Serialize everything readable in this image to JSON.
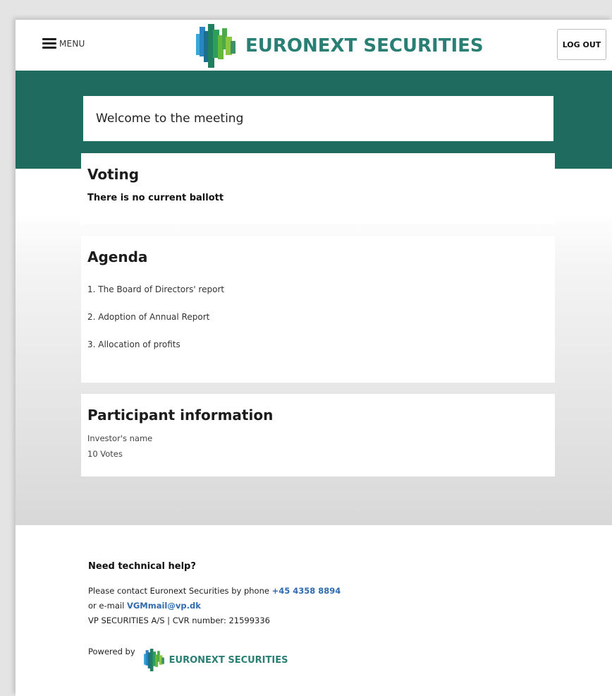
{
  "header": {
    "menu_label": "MENU",
    "brand": "EURONEXT SECURITIES",
    "logout_label": "LOG OUT"
  },
  "welcome": "Welcome to the meeting",
  "voting": {
    "title": "Voting",
    "message": "There is no current ballott"
  },
  "agenda": {
    "title": "Agenda",
    "items": [
      "1. The Board of Directors' report",
      "2. Adoption of Annual Report",
      "3. Allocation of profits"
    ]
  },
  "participant": {
    "title": "Participant information",
    "name": "Investor's name",
    "votes": "10 Votes"
  },
  "footer": {
    "help_title": "Need technical help?",
    "contact_prefix": "Please contact Euronext Securities by phone",
    "phone": "+45 4358 8894",
    "email_prefix": "or e-mail",
    "email": "VGMmail@vp.dk",
    "company": "VP SECURITIES A/S | CVR number: 21599336",
    "powered_by": "Powered by",
    "brand": "EURONEXT SECURITIES"
  },
  "colors": {
    "teal": "#1f6b60",
    "brand_text": "#2a7f74",
    "link": "#2f6bb0"
  }
}
